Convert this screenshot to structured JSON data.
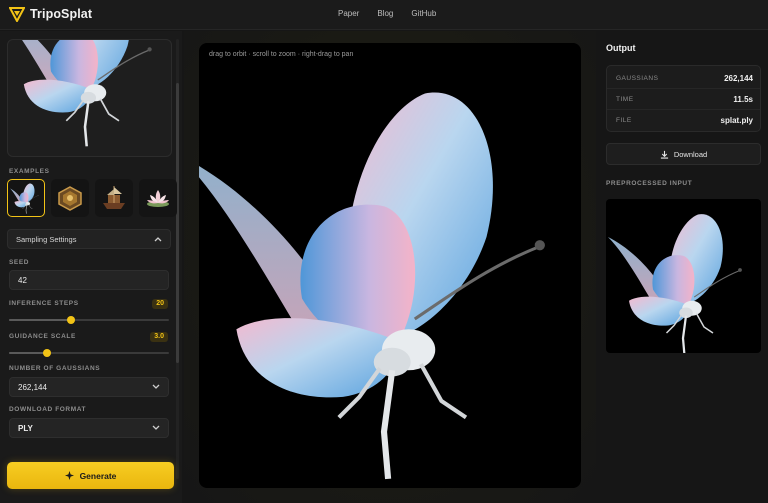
{
  "app": {
    "name": "TripoSplat"
  },
  "nav": {
    "items": [
      "Paper",
      "Blog",
      "GitHub"
    ]
  },
  "sidebar": {
    "examples_label": "EXAMPLES",
    "examples": [
      {
        "name": "butterfly",
        "icon": "butterfly-icon"
      },
      {
        "name": "ornate-box",
        "icon": "ornate-box-icon"
      },
      {
        "name": "ship",
        "icon": "ship-icon"
      },
      {
        "name": "lotus",
        "icon": "lotus-icon"
      }
    ],
    "accordion_label": "Sampling Settings",
    "seed": {
      "label": "SEED",
      "value": "42"
    },
    "inference_steps": {
      "label": "INFERENCE STEPS",
      "value": "20",
      "level": 0.39
    },
    "guidance_scale": {
      "label": "GUIDANCE SCALE",
      "value": "3.0",
      "level": 0.24
    },
    "num_gaussians": {
      "label": "NUMBER OF GAUSSIANS",
      "value": "262,144"
    },
    "download_format": {
      "label": "DOWNLOAD FORMAT",
      "value": "PLY"
    },
    "generate_label": "Generate"
  },
  "viewer": {
    "hint": "drag to orbit · scroll to zoom · right-drag to pan"
  },
  "output": {
    "title": "Output",
    "stats": [
      {
        "key": "GAUSSIANS",
        "value": "262,144"
      },
      {
        "key": "TIME",
        "value": "11.5s"
      },
      {
        "key": "FILE",
        "value": "splat.ply"
      }
    ],
    "download_label": "Download",
    "preprocessed_label": "PREPROCESSED INPUT"
  },
  "colors": {
    "accent": "#f2c316",
    "background": "#161616",
    "panel": "#1a1a1a"
  }
}
